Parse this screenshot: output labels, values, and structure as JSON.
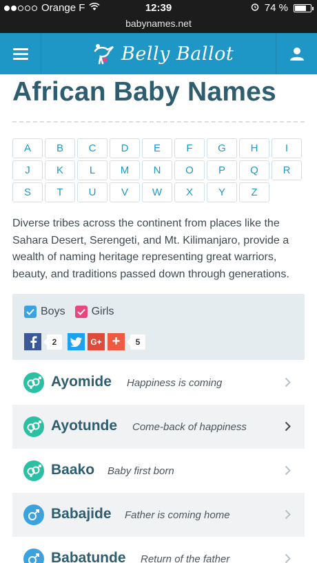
{
  "status": {
    "carrier": "Orange F",
    "time": "12:39",
    "battery": "74 %",
    "battery_level": 0.74
  },
  "browser": {
    "url": "babynames.net"
  },
  "header": {
    "logo_text": "Belly Ballot"
  },
  "page": {
    "title": "African Baby Names",
    "letters": [
      "A",
      "B",
      "C",
      "D",
      "E",
      "F",
      "G",
      "H",
      "I",
      "J",
      "K",
      "L",
      "M",
      "N",
      "O",
      "P",
      "Q",
      "R",
      "S",
      "T",
      "U",
      "V",
      "W",
      "X",
      "Y",
      "Z"
    ],
    "intro": "Diverse tribes across the continent from places like the Sahara Desert, Serengeti, and Mt. Kilimanjaro, provide a wealth of naming heritage representing great warriors, beauty, and traditions passed down through generations."
  },
  "filters": {
    "boys_label": "Boys",
    "girls_label": "Girls",
    "facebook_count": "2",
    "plus_count": "5"
  },
  "names": [
    {
      "name": "Ayomide",
      "meaning": "Happiness is coming",
      "gender": "unisex",
      "shaded": false
    },
    {
      "name": "Ayotunde",
      "meaning": "Come-back of happiness",
      "gender": "unisex",
      "shaded": true
    },
    {
      "name": "Baako",
      "meaning": "Baby first born",
      "gender": "unisex",
      "shaded": false
    },
    {
      "name": "Babajide",
      "meaning": "Father is coming home",
      "gender": "boy",
      "shaded": true
    },
    {
      "name": "Babatunde",
      "meaning": "Return of the father",
      "gender": "boy",
      "shaded": false
    }
  ],
  "colors": {
    "brand_blue": "#1f97c6",
    "title": "#2d5d6e",
    "unisex_green": "#2bbfa4",
    "boy_blue": "#3aa3df",
    "girls_pink": "#e8467c",
    "facebook": "#3b5998",
    "twitter": "#1da1f2",
    "googleplus": "#dd4b39",
    "share": "#ee5b43"
  }
}
